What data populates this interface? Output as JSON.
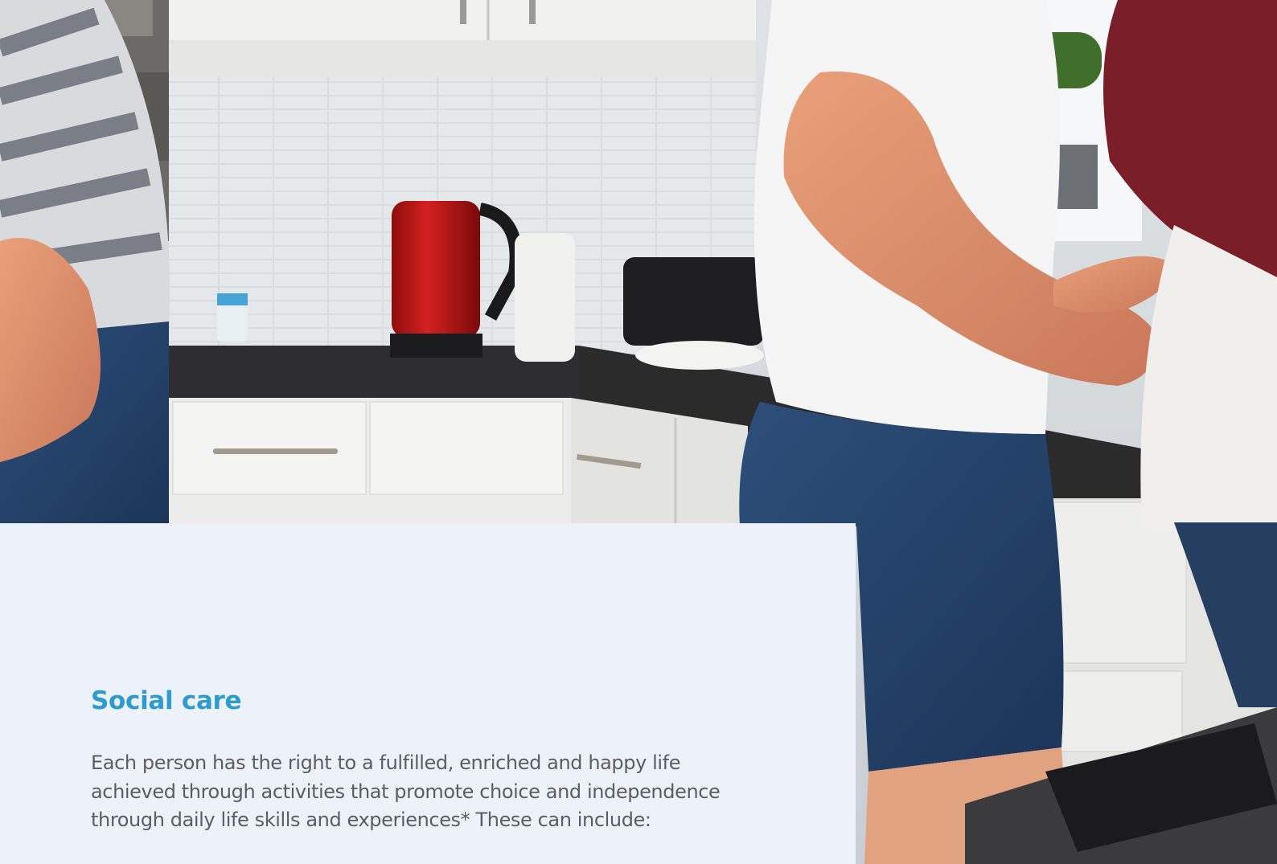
{
  "photo": {
    "subject": "kitchen-scene-with-people"
  },
  "section": {
    "heading": "Social care",
    "body_lines": [
      "Each person has the right to a fulfilled, enriched and happy life",
      "achieved through activities that promote choice and independence",
      "through daily life skills and experiences* These can include:"
    ]
  },
  "colors": {
    "heading": "#2e9bcf",
    "panel_background": "#edf2fa",
    "body_text": "#5a5d62"
  }
}
